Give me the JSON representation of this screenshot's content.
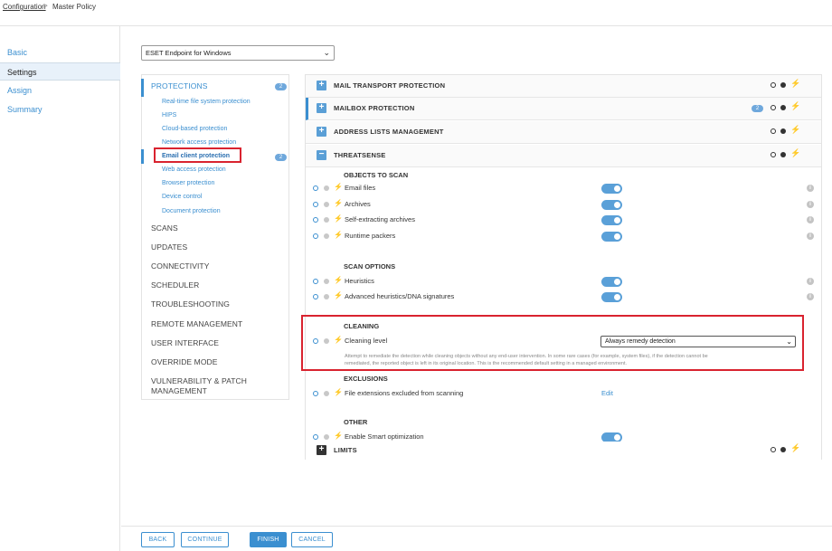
{
  "breadcrumb": {
    "first": "Configuration",
    "separator": ">",
    "second": "Master Policy"
  },
  "leftnav": {
    "items": [
      "Basic",
      "Settings",
      "Assign",
      "Summary"
    ],
    "active": "Settings"
  },
  "product_select": {
    "value": "ESET Endpoint for Windows"
  },
  "categories": {
    "protections": {
      "label": "PROTECTIONS",
      "badge": "2"
    },
    "subitems": [
      "Real-time file system protection",
      "HIPS",
      "Cloud-based protection",
      "Network access protection",
      "Email client protection",
      "Web access protection",
      "Browser protection",
      "Device control",
      "Document protection"
    ],
    "email_badge": "2",
    "others": [
      "SCANS",
      "UPDATES",
      "CONNECTIVITY",
      "SCHEDULER",
      "TROUBLESHOOTING",
      "REMOTE MANAGEMENT",
      "USER INTERFACE",
      "OVERRIDE MODE",
      "VULNERABILITY & PATCH",
      "MANAGEMENT"
    ]
  },
  "sections": {
    "mail_transport": {
      "title": "MAIL TRANSPORT PROTECTION"
    },
    "mailbox": {
      "title": "MAILBOX PROTECTION",
      "badge": "2"
    },
    "address_lists": {
      "title": "ADDRESS LISTS MANAGEMENT"
    },
    "threatsense": {
      "title": "THREATSENSE",
      "objects_heading": "OBJECTS TO SCAN",
      "objects": [
        "Email files",
        "Archives",
        "Self-extracting archives",
        "Runtime packers"
      ],
      "options_heading": "SCAN OPTIONS",
      "options": [
        "Heuristics",
        "Advanced heuristics/DNA signatures"
      ],
      "cleaning_heading": "CLEANING",
      "cleaning_label": "Cleaning level",
      "cleaning_value": "Always remedy detection",
      "cleaning_desc_1": "Attempt to remediate the detection while cleaning objects without any end-user intervention. In some rare cases (for example, system files), if the detection cannot be",
      "cleaning_desc_2": "remediated, the reported object is left in its original location. This is the recommended default setting in a managed environment.",
      "exclusions_heading": "EXCLUSIONS",
      "exclusions_label": "File extensions excluded from scanning",
      "exclusions_action": "Edit",
      "other_heading": "OTHER",
      "other_label": "Enable Smart optimization"
    },
    "limits": {
      "title": "LIMITS"
    }
  },
  "footer": {
    "back": "BACK",
    "continue": "CONTINUE",
    "finish": "FINISH",
    "cancel": "CANCEL"
  },
  "icons": {
    "expand": "+",
    "collapse": "−",
    "bolt": "⚡",
    "info": "i",
    "chevron": "⌄"
  },
  "colors": {
    "accent": "#3b8fd0",
    "highlight": "#d9232f"
  }
}
